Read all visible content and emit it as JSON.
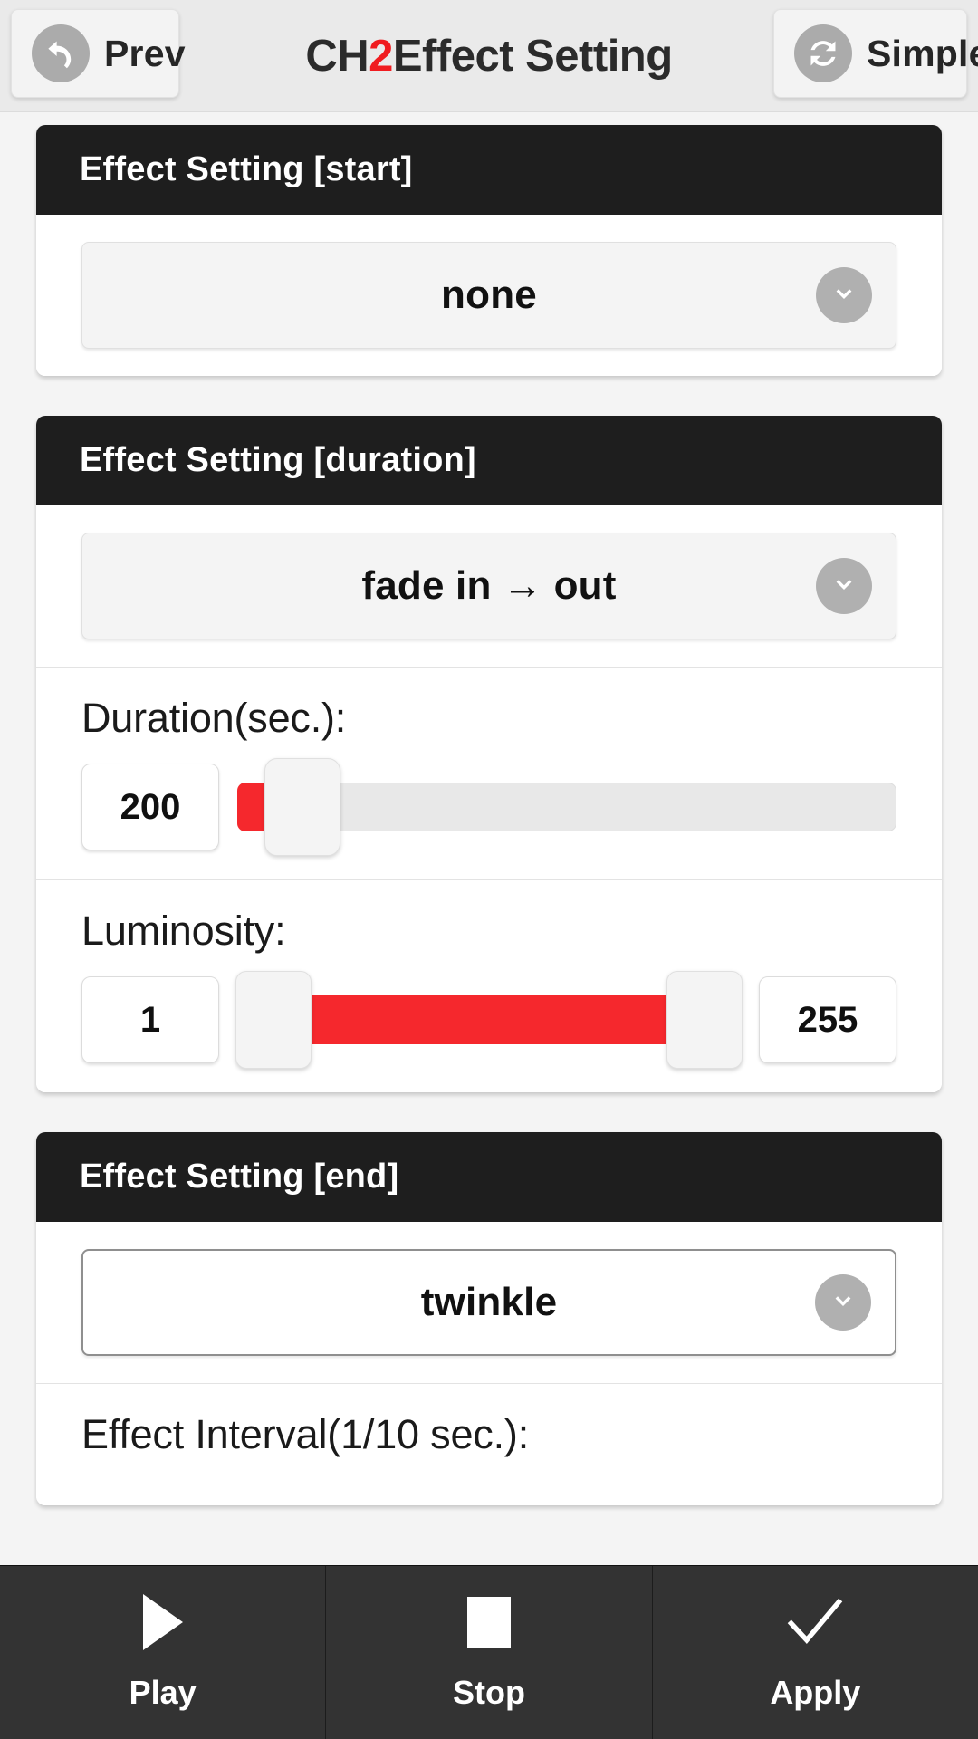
{
  "header": {
    "prev_label": "Prev",
    "prev_icon": "undo-back-arrow-icon",
    "simple_label": "Simple",
    "simple_icon": "refresh-sync-icon",
    "title_prefix": "CH",
    "title_channel": "2",
    "title_suffix": " Effect Setting",
    "accent_color": "#f01c20"
  },
  "cards": [
    {
      "title": "Effect Setting [start]",
      "select_value": "none",
      "select_icon": "chevron-down-icon"
    },
    {
      "title": "Effect Setting [duration]",
      "select_value": "fade in → out",
      "select_icon": "chevron-down-icon",
      "duration": {
        "label": "Duration(sec.):",
        "value": "200",
        "min": 0,
        "max": 3000,
        "percent": 4
      },
      "luminosity": {
        "label": "Luminosity:",
        "min_value": "1",
        "max_value": "255",
        "min": 1,
        "max": 255,
        "low_percent": 3,
        "high_percent": 97
      }
    },
    {
      "title": "Effect Setting [end]",
      "select_value": "twinkle",
      "select_icon": "chevron-down-icon",
      "interval_label": "Effect Interval(1/10 sec.):"
    }
  ],
  "bottom_bar": {
    "buttons": [
      {
        "label": "Play",
        "icon": "play-triangle-icon"
      },
      {
        "label": "Stop",
        "icon": "stop-square-icon"
      },
      {
        "label": "Apply",
        "icon": "check-mark-icon"
      }
    ]
  },
  "colors": {
    "slider_fill": "#f5282d",
    "card_header_bg": "#1e1e1e",
    "bottom_bar_bg": "#333333"
  }
}
